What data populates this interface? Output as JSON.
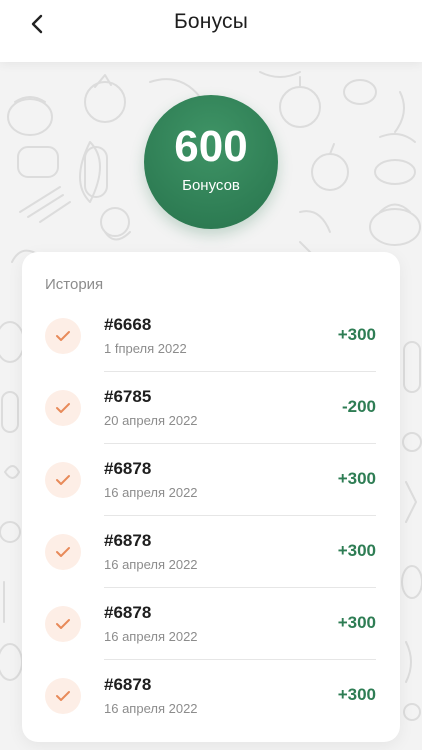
{
  "header": {
    "title": "Бонусы",
    "back_icon": "chevron-left-icon"
  },
  "bonus": {
    "value": "600",
    "label": "Бонусов",
    "color": "#2e7d54"
  },
  "history": {
    "title": "История",
    "items": [
      {
        "order": "#6668",
        "date": "1 fпреля 2022",
        "amount": "+300",
        "icon": "check-icon"
      },
      {
        "order": "#6785",
        "date": "20 апреля 2022",
        "amount": "-200",
        "icon": "check-icon"
      },
      {
        "order": "#6878",
        "date": "16 апреля 2022",
        "amount": "+300",
        "icon": "check-icon"
      },
      {
        "order": "#6878",
        "date": "16 апреля 2022",
        "amount": "+300",
        "icon": "check-icon"
      },
      {
        "order": "#6878",
        "date": "16 апреля 2022",
        "amount": "+300",
        "icon": "check-icon"
      },
      {
        "order": "#6878",
        "date": "16 апреля 2022",
        "amount": "+300",
        "icon": "check-icon"
      }
    ]
  },
  "colors": {
    "accent_green": "#2e7d54",
    "check_orange": "#e88a5a",
    "check_bg": "#fdeee6"
  }
}
